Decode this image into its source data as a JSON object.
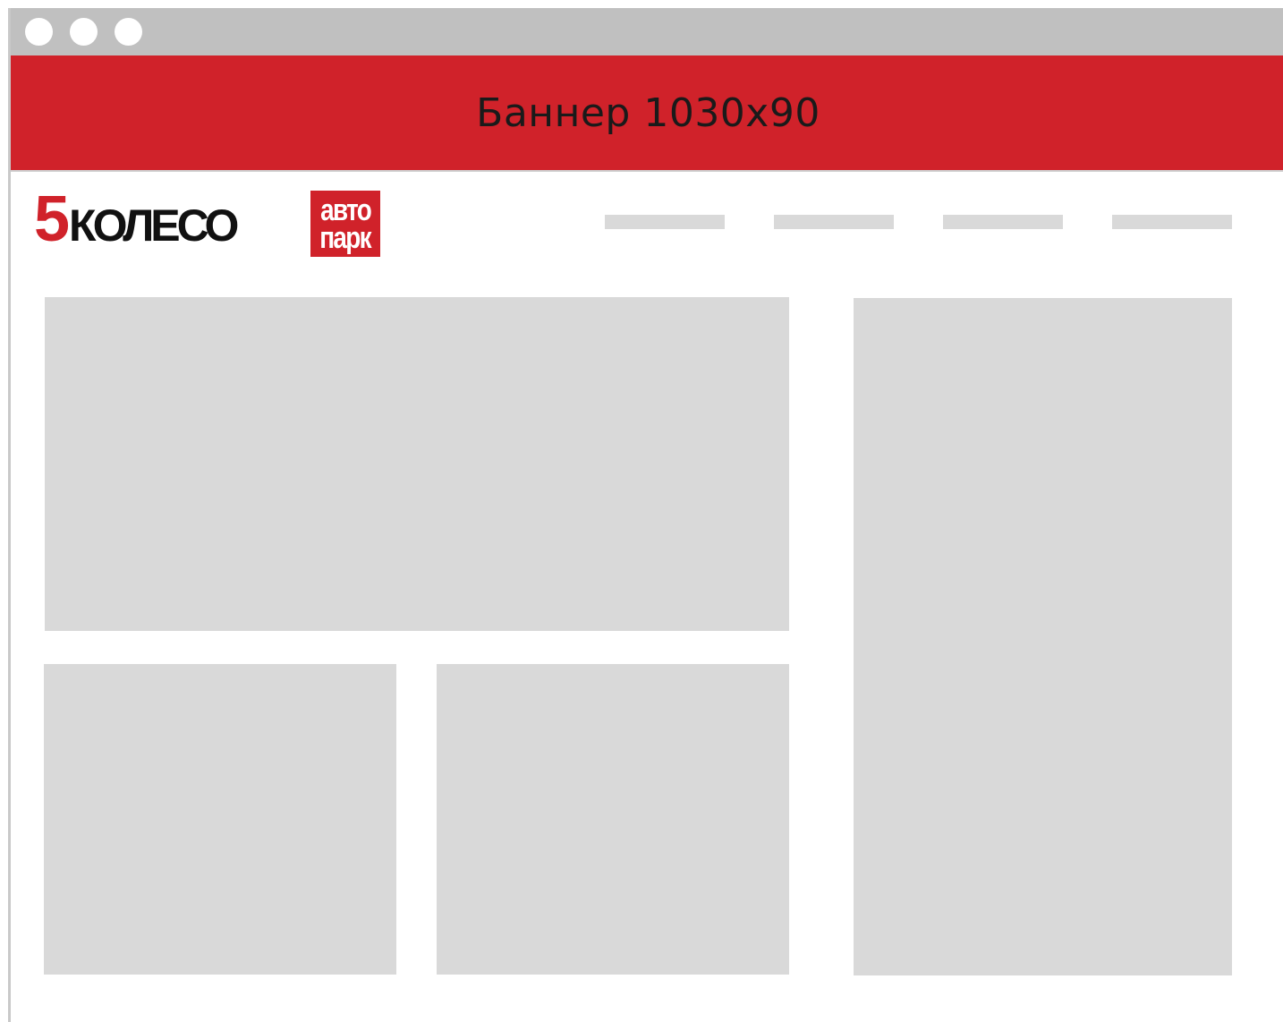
{
  "window": {
    "controls": [
      "window-dot",
      "window-dot",
      "window-dot"
    ]
  },
  "banner": {
    "label": "Баннер 1030x90",
    "color": "#d0222a"
  },
  "logo": {
    "number": "5",
    "word": "КОЛЕСО",
    "badge_line1": "авто",
    "badge_line2": "парк",
    "accent_color": "#d0222a"
  },
  "nav": {
    "items": [
      "placeholder",
      "placeholder",
      "placeholder",
      "placeholder"
    ],
    "placeholder_color": "#d9d9d9"
  },
  "content": {
    "blocks": [
      "hero-block",
      "card-block",
      "card-block",
      "sidebar-block"
    ],
    "placeholder_color": "#d9d9d9"
  }
}
